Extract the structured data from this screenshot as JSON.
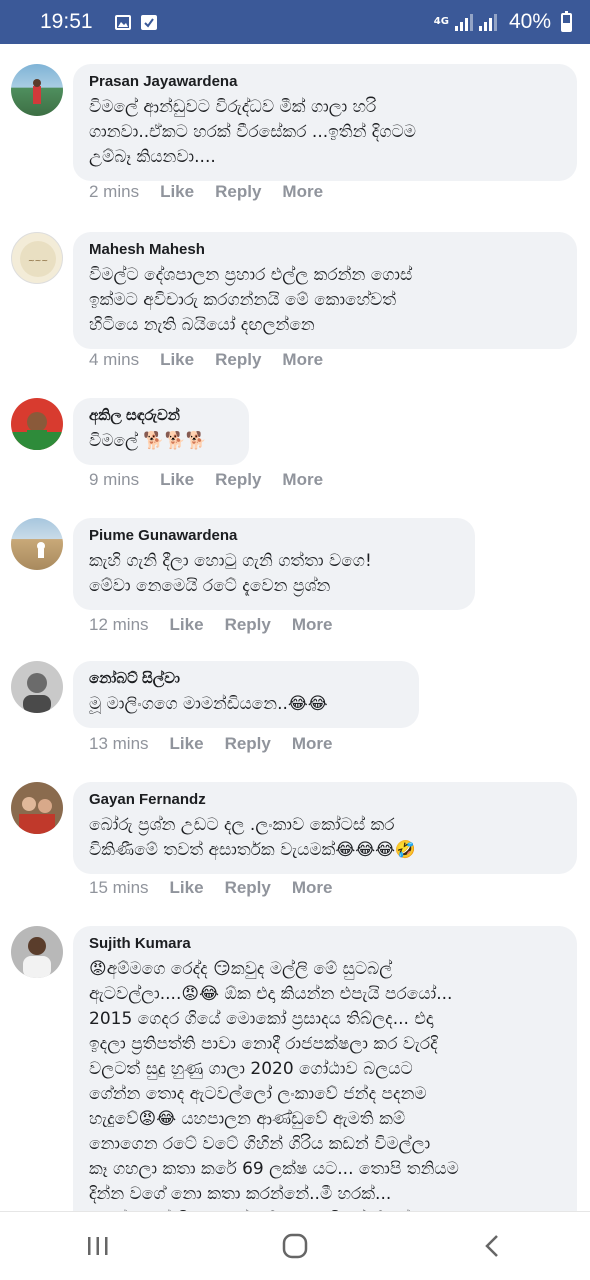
{
  "status_bar": {
    "time": "19:51",
    "network": "4G",
    "battery": "40%"
  },
  "actions": {
    "like": "Like",
    "reply": "Reply",
    "more": "More"
  },
  "comments": [
    {
      "author": "Prasan Jayawardena",
      "text": "විමලේ ආන්ඩුවට විරුද්ධව මීක් ගාලා හරි\nගානවා..ඒකට හරක් වීරසේකර ...ඉතින් දිගටම\nඋම්බෑ කියනවා....",
      "time": "2 mins"
    },
    {
      "author": "Mahesh Mahesh",
      "text": "විමල්ට දේශපාලන ප්‍රහාර එල්ල කරන්න ගොස්\nඉක්මට අවිචාරු කරගන්නයි මේ කොහේවත්\nහිටියෙ නැති බයියෝ දඟලන්නෙ",
      "time": "4 mins"
    },
    {
      "author": "අකිල සඳරුවන්",
      "text": "විමලේ 🐕🐕🐕",
      "time": "9 mins"
    },
    {
      "author": "Piume Gunawardena",
      "text": "කැහි ගැනි දීලා හොටු ගැනි ගත්තා වගෙ!\nමේවා නෙමෙයි රටේ දැවෙන ප්‍රශ්න",
      "time": "12 mins"
    },
    {
      "author": "නෝබට් සිල්වා",
      "text": "මූ මාලිංගගෙ මාමන්ඩියනෙ..😂😂",
      "time": "13 mins"
    },
    {
      "author": "Gayan Fernandz",
      "text": "බෝරු ප්‍රශ්න උඩට දල .ලංකාව කෝටස් කර\nවිකිණීමේ තවත් අසාර්තක වැයමක්😂😂😂🤣",
      "time": "15 mins"
    },
    {
      "author": "Sujith Kumara",
      "text": "😡අම්මගෙ රෙද්ද 😏කවුද මල්ලි මේ සුටබල්\nඇටවල්ලා....😡😂 ඕක එදා කියන්න එපැයි පරයෝ...\n2015 ගෙදර ගියේ මොකෝ ප්‍රසාදය තිබ්ලද... එදා\nඉදලා ප්‍රතිපත්ති පාවා නොදී රාජපක්ෂලා කර වැරදි\nවලටත් සුදු හුණු ගාලා 2020 ගෝඨාව බලයට\nගේන්න තොද ඇටවල්ලෝ ලංකාවේ ජන්ද පදනම\nහැදුවේ😡😂 යහපාලන ආණ්ඩුවේ ඇමති කම්\nනොගෙන රටේ වටේ ගිහින් ගිරිය කඩන් විමල්ලා\nකෑ ගහලා කතා කරේ 69 ලක්ෂ යට... තොපි තනියම\nදින්න වගේ නො කතා කරන්නේ..මී හරක්...\nමහත්තයෝ මී හරකෝ මේ අහපං විමල් කියන්නෙ"
    }
  ]
}
